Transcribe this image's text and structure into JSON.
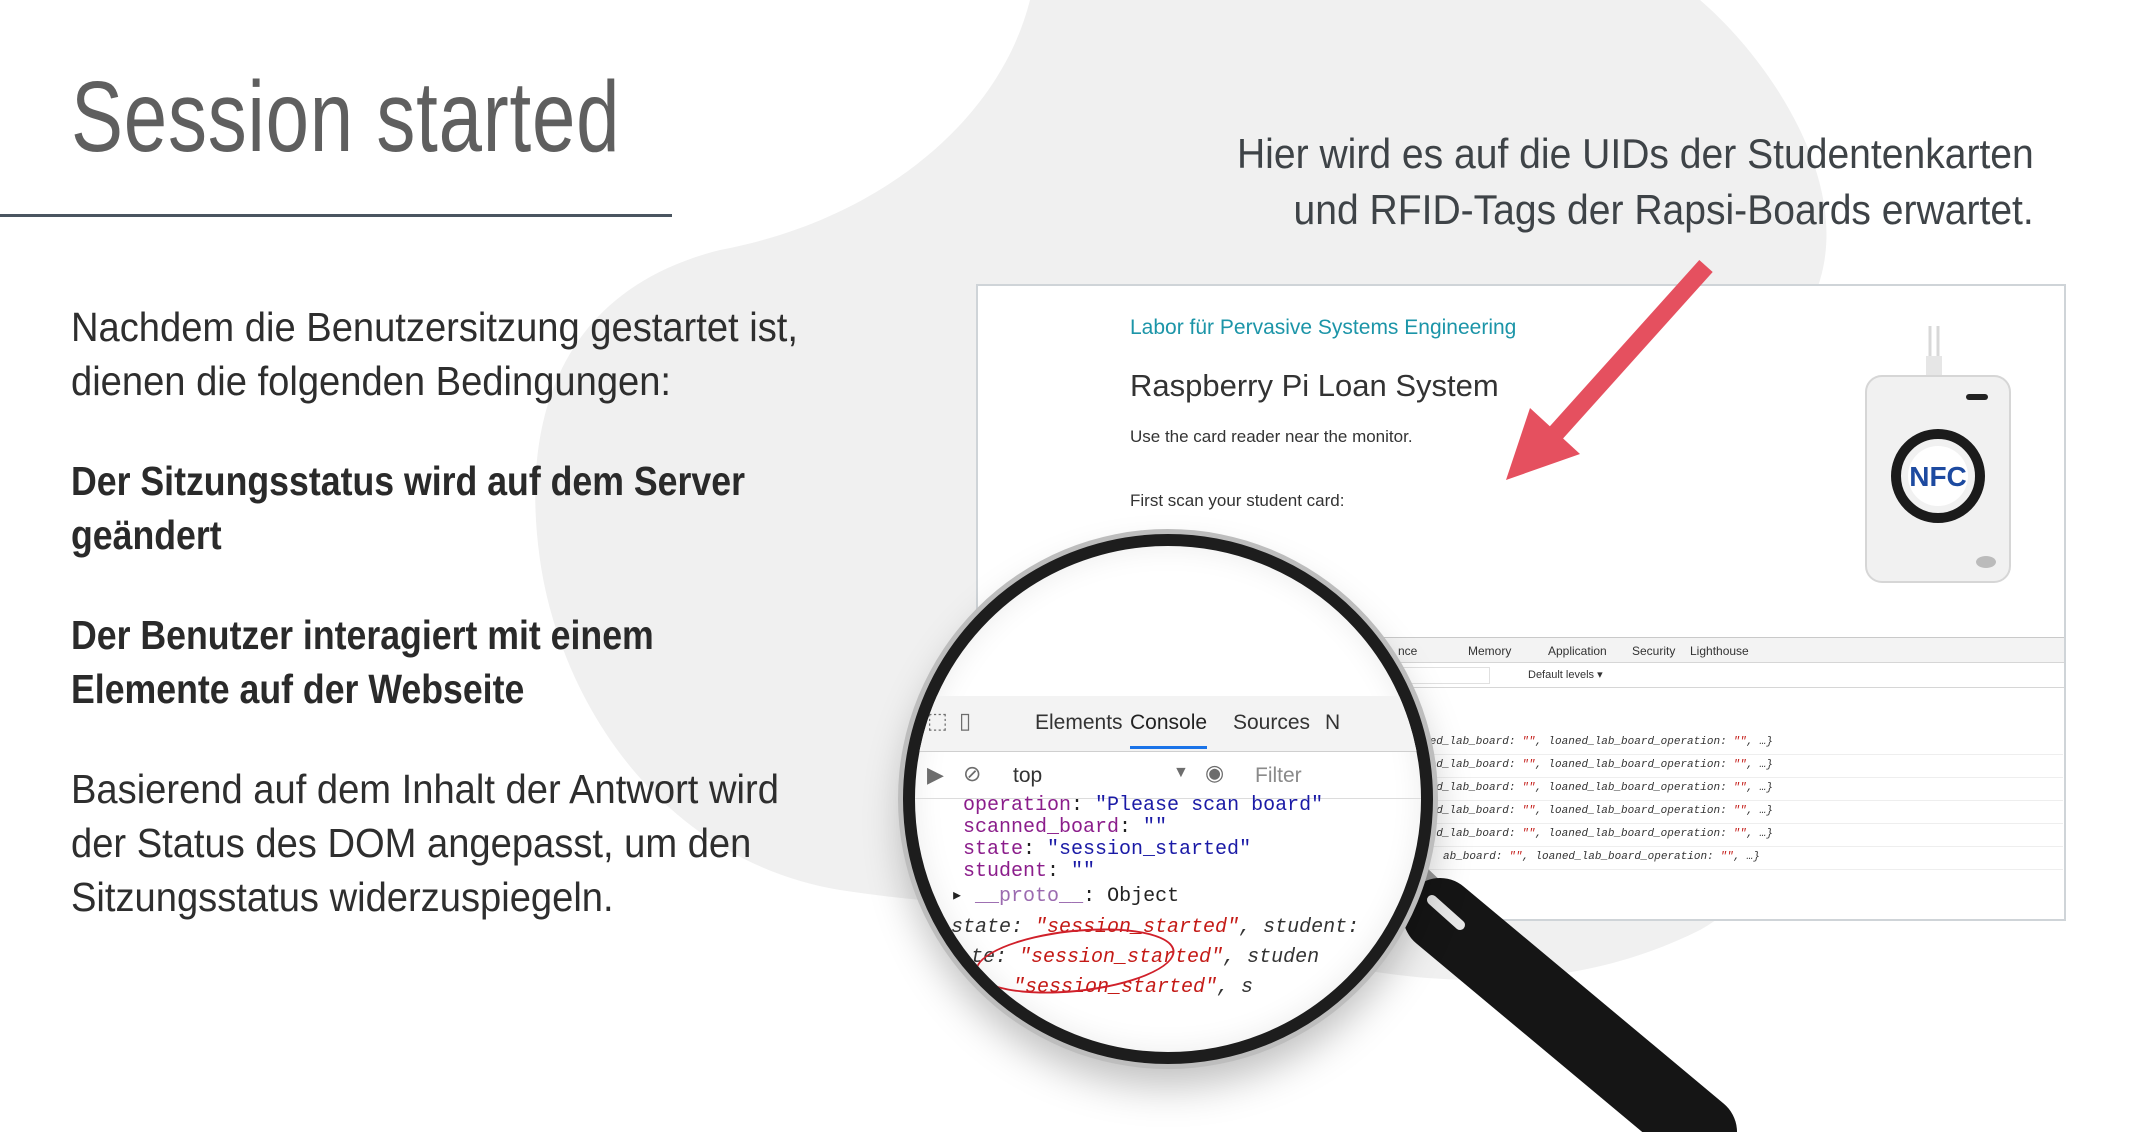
{
  "slide": {
    "title": "Session started",
    "annotation_line1": "Hier wird es auf die UIDs der Studentenkarten",
    "annotation_line2": "und RFID-Tags der Rapsi-Boards erwartet.",
    "intro": "Nachdem die Benutzersitzung gestartet ist, dienen die folgenden Bedingungen:",
    "condition1": "Der Sitzungsstatus wird auf dem Server geändert",
    "condition2": "Der Benutzer interagiert mit einem Elemente auf der Webseite",
    "conclusion": "Basierend auf dem Inhalt der Antwort wird der Status des DOM angepasst, um den Sitzungsstatus widerzuspiegeln."
  },
  "app": {
    "lab_name": "Labor für Pervasive Systems Engineering",
    "title": "Raspberry Pi Loan System",
    "hint": "Use the card reader near the monitor.",
    "scan_prompt": "First scan your student card:",
    "reader_label": "NFC"
  },
  "devtools": {
    "tabs": [
      "nce",
      "Memory",
      "Application",
      "Security",
      "Lighthouse"
    ],
    "levels": "Default levels ▾",
    "log_rows": [
      {
        "pre": "ned_lab_board: ",
        "q1": "\"\"",
        "mid": ", loaned_lab_board_operation: ",
        "q2": "\"\"",
        "end": ", …}"
      },
      {
        "pre": "ned_lab_board: ",
        "q1": "\"\"",
        "mid": ", loaned_lab_board_operation: ",
        "q2": "\"\"",
        "end": ", …}"
      },
      {
        "pre": "ned_lab_board: ",
        "q1": "\"\"",
        "mid": ", loaned_lab_board_operation: ",
        "q2": "\"\"",
        "end": ", …}"
      },
      {
        "pre": "ned_lab_board: ",
        "q1": "\"\"",
        "mid": ", loaned_lab_board_operation: ",
        "q2": "\"\"",
        "end": ", …}"
      },
      {
        "pre": "ned_lab_board: ",
        "q1": "\"\"",
        "mid": ", loaned_lab_board_operation: ",
        "q2": "\"\"",
        "end": ", …}"
      },
      {
        "pre": "ab_board: ",
        "q1": "\"\"",
        "mid": ", loaned_lab_board_operation: ",
        "q2": "\"\"",
        "end": ", …}"
      }
    ]
  },
  "magnified": {
    "tab_elements": "Elements",
    "tab_console": "Console",
    "tab_sources": "Sources",
    "tab_more": "N",
    "context": "top",
    "filter_placeholder": "Filter",
    "line_operation_key": "operation",
    "line_operation_val": "\"Please scan board\"",
    "line_scanned_key": "scanned_board",
    "line_scanned_val": "\"\"",
    "line_state_key": "state",
    "line_state_val": "\"session_started\"",
    "line_student_key": "student",
    "line_student_val": "\"\"",
    "line_proto_key": "__proto__",
    "line_proto_val": "Object",
    "log1_key": "state: ",
    "log1_val": "\"session_started\"",
    "log1_rest": ", student:",
    "log2_key": "te: ",
    "log2_val": "\"session_started\"",
    "log2_rest": ", studen",
    "log3_val": "\"session_started\"",
    "log3_rest": ", s"
  },
  "colors": {
    "arrow": "#e5505f",
    "accent_teal": "#1c95a8",
    "highlight_circle": "#d0202a",
    "blob": "#f0f0f0"
  }
}
